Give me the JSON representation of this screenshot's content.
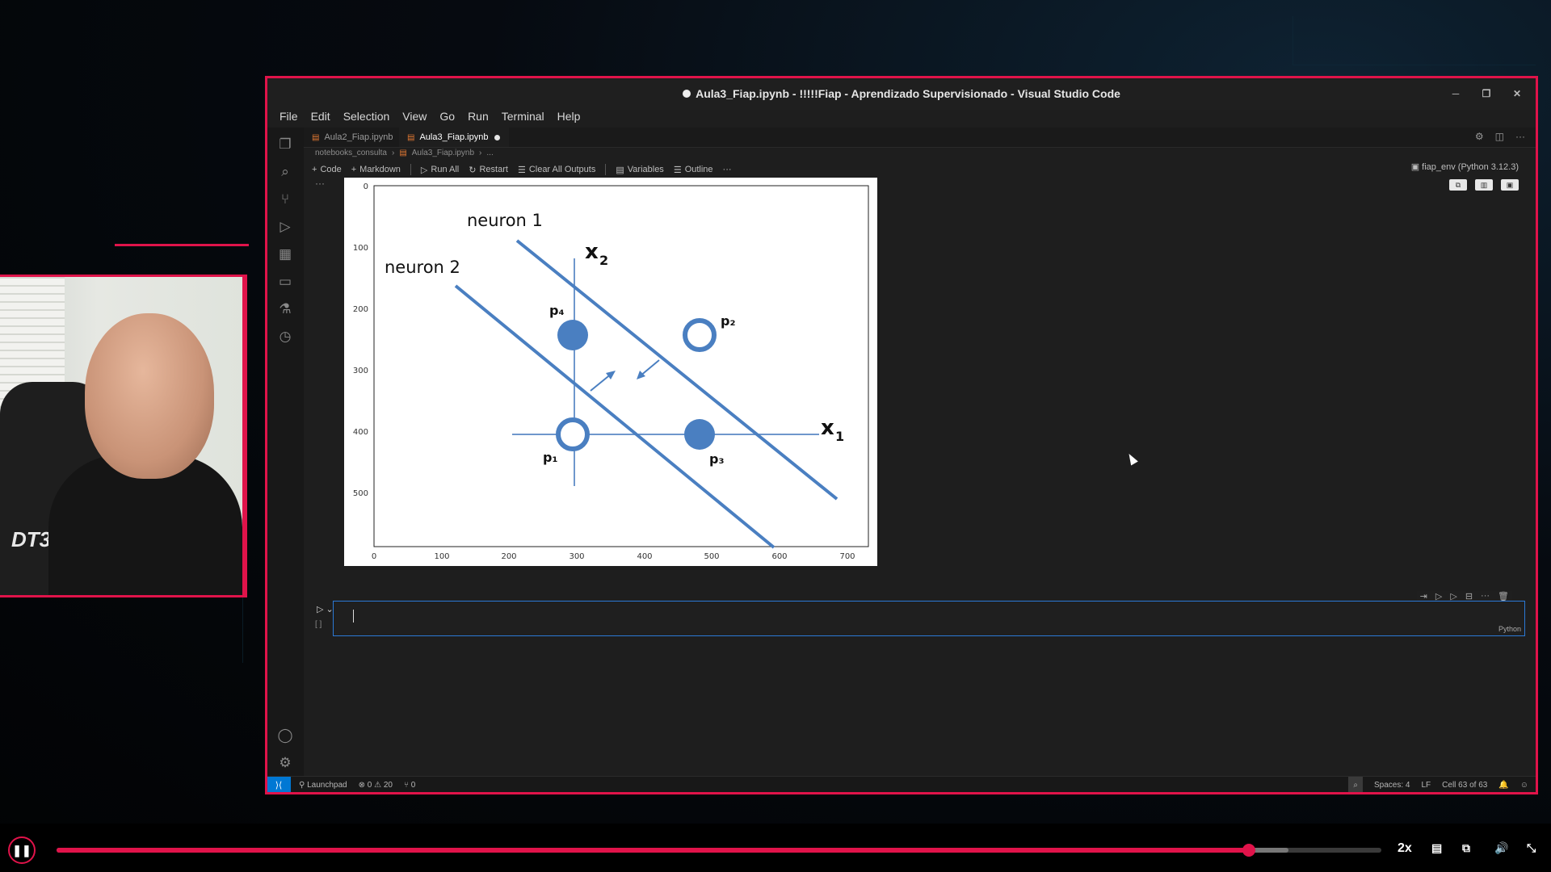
{
  "colors": {
    "accent": "#e0134a",
    "editor_bg": "#1e1e1e",
    "focus_blue": "#2b79d6",
    "plot_blue": "#4a7fc1"
  },
  "webcam": {
    "chair_logo": "DT3"
  },
  "window": {
    "title": "Aula3_Fiap.ipynb - !!!!!Fiap - Aprendizado Supervisionado - Visual Studio Code",
    "controls": [
      "minimize-icon",
      "restore-icon",
      "close-icon"
    ]
  },
  "menu": [
    "File",
    "Edit",
    "Selection",
    "View",
    "Go",
    "Run",
    "Terminal",
    "Help"
  ],
  "activity_icons": [
    "explorer-icon",
    "search-icon",
    "source-control-icon",
    "run-debug-icon",
    "extensions-icon",
    "remote-explorer-icon",
    "testing-icon",
    "timeline-icon",
    "account-icon",
    "settings-gear-icon"
  ],
  "tabs": [
    {
      "label": "Aula2_Fiap.ipynb",
      "active": false
    },
    {
      "label": "Aula3_Fiap.ipynb",
      "active": true,
      "modified": true
    }
  ],
  "breadcrumb": {
    "folder": "notebooks_consulta",
    "file": "Aula3_Fiap.ipynb",
    "more": "..."
  },
  "toolbar": {
    "code": "Code",
    "markdown": "Markdown",
    "run_all": "Run All",
    "restart": "Restart",
    "clear": "Clear All Outputs",
    "variables": "Variables",
    "outline": "Outline",
    "more": "···",
    "kernel": "fiap_env (Python 3.12.3)"
  },
  "output": {
    "x_ticks": [
      "0",
      "100",
      "200",
      "300",
      "400",
      "500",
      "600",
      "700"
    ],
    "y_ticks": [
      "0",
      "100",
      "200",
      "300",
      "400",
      "500"
    ],
    "neuron1": "neuron 1",
    "neuron2": "neuron 2",
    "x1_main": "x",
    "x1_sub": "1",
    "x2_main": "x",
    "x2_sub": "2",
    "p1": "p₁",
    "p2": "p₂",
    "p3": "p₃",
    "p4": "p₄"
  },
  "cell": {
    "exec_label": "[ ]",
    "language": "Python"
  },
  "status": {
    "launchpad": "Launchpad",
    "problems": "⊗ 0 ⚠ 20",
    "ports": "⑂ 0",
    "spaces": "Spaces: 4",
    "eol": "LF",
    "cell_position": "Cell 63 of 63"
  },
  "player": {
    "speed": "2x",
    "progress": 0.9,
    "buffered": 0.93
  }
}
